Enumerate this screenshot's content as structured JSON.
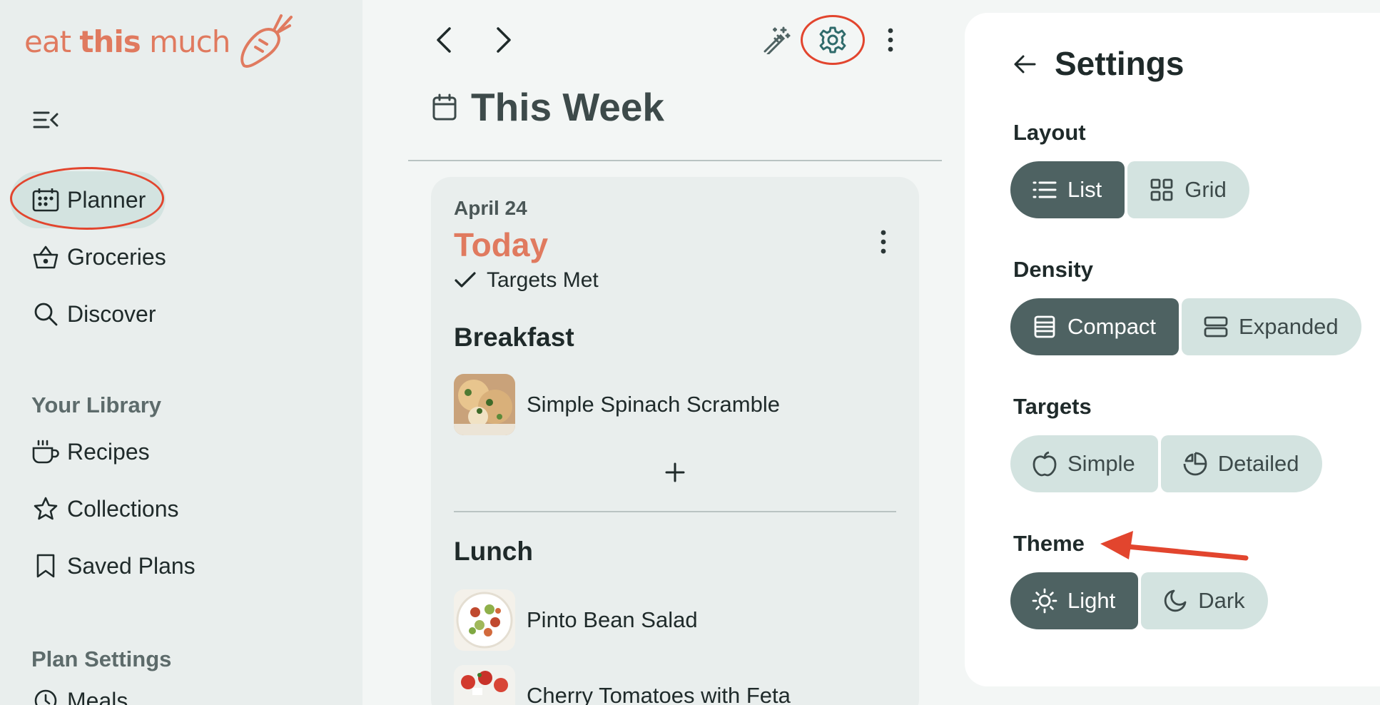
{
  "brand": {
    "logo_light": "eat ",
    "logo_bold": "this",
    "logo_tail": " much",
    "color": "#e07a5f"
  },
  "sidebar": {
    "nav": [
      {
        "label": "Planner",
        "icon": "calendar-grid-icon",
        "active": true
      },
      {
        "label": "Groceries",
        "icon": "basket-icon"
      },
      {
        "label": "Discover",
        "icon": "search-icon"
      }
    ],
    "library_title": "Your Library",
    "library": [
      {
        "label": "Recipes",
        "icon": "mug-icon"
      },
      {
        "label": "Collections",
        "icon": "star-icon"
      },
      {
        "label": "Saved Plans",
        "icon": "bookmark-icon"
      }
    ],
    "plan_settings_title": "Plan Settings",
    "plan_settings": [
      {
        "label": "Meals",
        "icon": "clock-icon"
      }
    ]
  },
  "main": {
    "title": "This Week",
    "day": {
      "date": "April 24",
      "label": "Today",
      "status": "Targets Met",
      "meals": [
        {
          "name": "Breakfast",
          "foods": [
            "Simple Spinach Scramble"
          ]
        },
        {
          "name": "Lunch",
          "foods": [
            "Pinto Bean Salad",
            "Cherry Tomatoes with Feta"
          ]
        }
      ]
    }
  },
  "settings": {
    "title": "Settings",
    "groups": [
      {
        "label": "Layout",
        "options": [
          {
            "label": "List",
            "icon": "list-icon",
            "selected": true
          },
          {
            "label": "Grid",
            "icon": "grid-icon",
            "selected": false
          }
        ]
      },
      {
        "label": "Density",
        "options": [
          {
            "label": "Compact",
            "icon": "compact-icon",
            "selected": true
          },
          {
            "label": "Expanded",
            "icon": "expanded-icon",
            "selected": false
          }
        ]
      },
      {
        "label": "Targets",
        "options": [
          {
            "label": "Simple",
            "icon": "apple-icon",
            "selected": false
          },
          {
            "label": "Detailed",
            "icon": "pie-icon",
            "selected": false
          }
        ]
      },
      {
        "label": "Theme",
        "options": [
          {
            "label": "Light",
            "icon": "sun-icon",
            "selected": true
          },
          {
            "label": "Dark",
            "icon": "moon-icon",
            "selected": false
          }
        ]
      }
    ]
  },
  "colors": {
    "accent": "#e07a5f",
    "selected": "#4e6262",
    "unselected": "#d3e3e0",
    "annotation": "#e2452e"
  }
}
